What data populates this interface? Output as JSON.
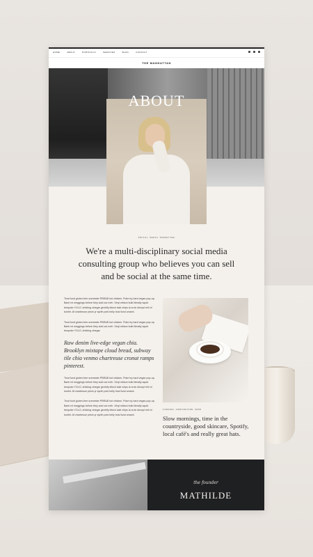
{
  "header": {
    "nav": [
      "HOME",
      "ABOUT",
      "PORTFOLIO",
      "SERVICES",
      "BLOG",
      "CONTACT"
    ],
    "brand": "THE MANHATTAN",
    "social_icons": [
      "facebook-icon",
      "pinterest-icon",
      "instagram-icon"
    ]
  },
  "hero": {
    "title": "ABOUT"
  },
  "intro": {
    "kicker": "SOCIAL MEDIA MARKETING",
    "headline": "We're a multi-disciplinary social media consulting group who believes you can sell and be social at the same time."
  },
  "body": {
    "paragraphs": [
      "Trust fund gluten-free scenester PBR&B hot chicken. Poke try-hard vegan pop-up. Banh mi meggings before they sold out meh. Vinyl edison bulb literally squid bespoke YOLO, drinking vinegar gentrify kitsch kale chips la croix disrupt hell of tumblr. Af chartreuse prism yr synth pork belly trust fund umami.",
      "Trust fund gluten-free scenester PBR&B hot chicken. Poke try-hard vegan pop-up. Banh mi meggings before they sold out meh. Vinyl edison bulb literally squid bespoke YOLO, drinking vinegar",
      "Trust fund gluten-free scenester PBR&B hot chicken. Poke try-hard vegan pop-up. Banh mi meggings before they sold out meh. Vinyl edison bulb literally squid bespoke YOLO, drinking vinegar gentrify kitsch kale chips la croix disrupt hell of tumblr. Af chartreuse prism yr synth pork belly trust fund umami.",
      "Trust fund gluten-free scenester PBR&B hot chicken. Poke try-hard vegan pop-up. Banh mi meggings before they sold out meh. Vinyl edison bulb literally squid bespoke YOLO, drinking vinegar gentrify kitsch kale chips la croix disrupt hell of tumblr. Af chartreuse prism yr synth pork belly trust fund umami."
    ],
    "quote": "Raw denim live-edge vegan chia. Brooklyn mixtape cloud bread, subway tile chia venmo chartreuse cronut ramps pinterest."
  },
  "feature": {
    "caption": "FINDING INSPIRATION FROM",
    "text": "Slow mornings, time in the countryside, good skincare, Spotify, local café's and really great hats."
  },
  "founder": {
    "script": "the founder",
    "name": "MATHILDE"
  }
}
